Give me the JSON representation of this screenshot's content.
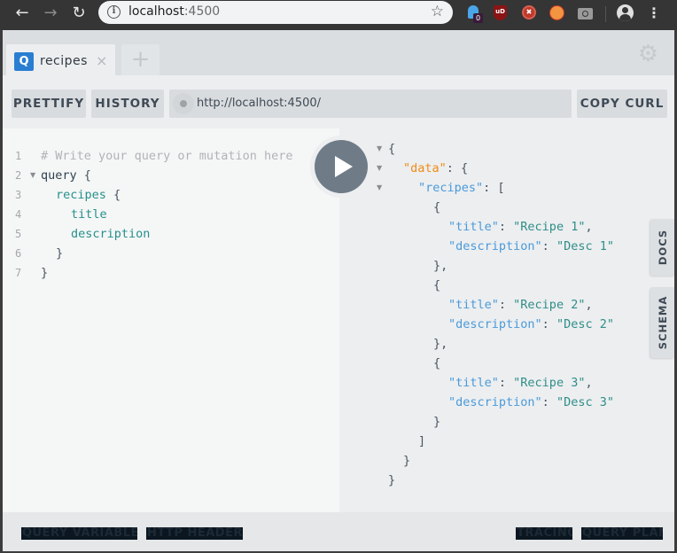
{
  "browser": {
    "back_icon": "arrow-left",
    "forward_icon": "arrow-right",
    "reload_icon": "reload",
    "url_host": "localhost",
    "url_port": ":4500",
    "extensions": [
      {
        "name": "ghostery",
        "badge": "0",
        "color": "#4aa6e8"
      },
      {
        "name": "ublock-origin",
        "label": "uD",
        "color": "#8b1414"
      },
      {
        "name": "red-circle-extension",
        "color": "#c0392b"
      },
      {
        "name": "hammer-extension",
        "color": "#f29440"
      },
      {
        "name": "camera-extension",
        "color": "#9a9a9a"
      }
    ]
  },
  "tabs": [
    {
      "badge": "Q",
      "label": "recipes",
      "close": "×"
    }
  ],
  "new_tab_label": "+",
  "toolbar": {
    "prettify": "PRETTIFY",
    "history": "HISTORY",
    "endpoint": "http://localhost:4500/",
    "copy_curl": "COPY CURL"
  },
  "editor": {
    "line_numbers": [
      "1",
      "2",
      "3",
      "4",
      "5",
      "6",
      "7"
    ],
    "lines": {
      "l1": "# Write your query or mutation here",
      "l2_kw": "query",
      "l2_p": " {",
      "l3_f": "recipes",
      "l3_p": " {",
      "l4_f": "title",
      "l5_f": "description",
      "l6_p": "}",
      "l7_p": "}"
    }
  },
  "result": {
    "open": "{",
    "data_key": "\"data\"",
    "colon_brace": ": {",
    "recipes_key": "\"recipes\"",
    "colon_bracket": ": [",
    "obj_open": "{",
    "title_key": "\"title\"",
    "desc_key": "\"description\"",
    "colon": ": ",
    "comma": ",",
    "obj_close_comma": "},",
    "obj_close": "}",
    "arr_close": "]",
    "items": [
      {
        "title": "\"Recipe 1\"",
        "description": "\"Desc 1\""
      },
      {
        "title": "\"Recipe 2\"",
        "description": "\"Desc 2\""
      },
      {
        "title": "\"Recipe 3\"",
        "description": "\"Desc 3\""
      }
    ]
  },
  "side_tabs": {
    "docs": "DOCS",
    "schema": "SCHEMA"
  },
  "bottom": {
    "query_variables": "QUERY VARIABLES",
    "http_headers": "HTTP HEADERS",
    "tracing": "TRACING",
    "query_plan": "QUERY PLAN"
  },
  "colors": {
    "accent_blue": "#2a7ed2",
    "run_button": "#6f7c88",
    "json_key": "#4b9ad9",
    "json_string": "#2f8e87",
    "data_key": "#f08c15"
  }
}
